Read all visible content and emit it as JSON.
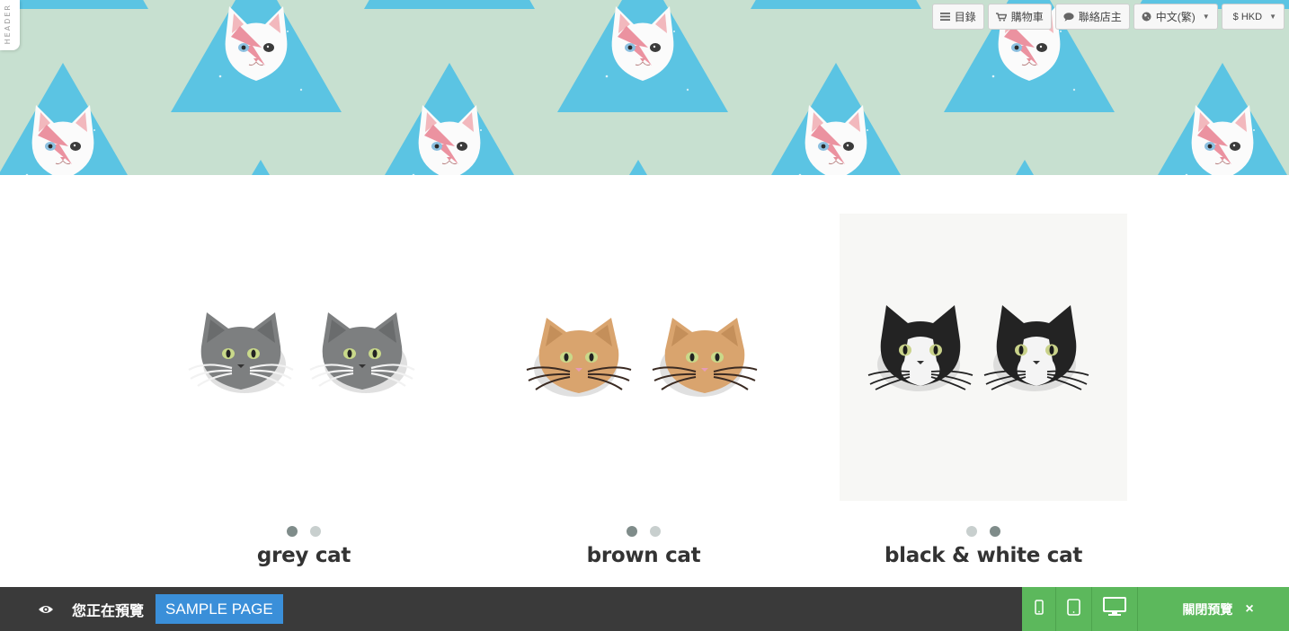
{
  "header": {
    "tag_label": "HEADER",
    "nav": {
      "catalog": "目錄",
      "cart": "購物車",
      "contact": "聯絡店主",
      "language": "中文(繁)",
      "currency": "$ HKD"
    },
    "icons": {
      "catalog": "menu-icon",
      "cart": "cart-icon",
      "contact": "chat-bubble-icon",
      "language": "globe-icon",
      "dropdown": "caret-down-icon"
    },
    "colors": {
      "banner_bg": "#c7e0d0",
      "triangle": "#5bc4e3"
    }
  },
  "products": [
    {
      "name": "grey cat",
      "slide_count": 2,
      "active_slide": 1
    },
    {
      "name": "brown cat",
      "slide_count": 2,
      "active_slide": 1
    },
    {
      "name": "black & white cat",
      "slide_count": 2,
      "active_slide": 2
    }
  ],
  "preview_bar": {
    "status_text": "您正在預覽",
    "page_name": "SAMPLE PAGE",
    "close_label": "關閉預覽",
    "close_icon": "×",
    "icons": [
      "eye-icon",
      "mobile-icon",
      "tablet-icon",
      "desktop-icon",
      "close-icon"
    ],
    "colors": {
      "bar_bg": "#3a3a3a",
      "page_badge": "#3a8fd9",
      "close_area": "#5cb85c"
    }
  }
}
